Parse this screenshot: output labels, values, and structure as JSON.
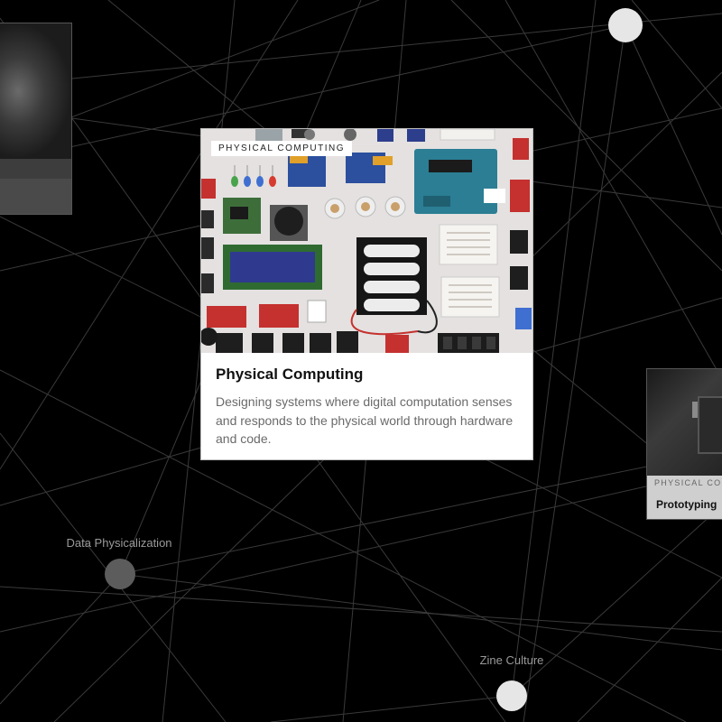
{
  "graph": {
    "nodes": [
      {
        "id": "top-right-node",
        "label": "",
        "fill": "#e6e6e6"
      },
      {
        "id": "data-physicalization",
        "label": "Data Physicalization",
        "fill": "#5c5c5c"
      },
      {
        "id": "zine-culture",
        "label": "Zine Culture",
        "fill": "#e6e6e6"
      }
    ],
    "edge_color": "#3a3a3a"
  },
  "main_card": {
    "tag": "PHYSICAL COMPUTING",
    "title": "Physical Computing",
    "description": "Designing systems where digital computation senses and responds to the physical world through hardware and code."
  },
  "right_card": {
    "tag": "PHYSICAL COMPUTING",
    "title": "Prototyping"
  }
}
